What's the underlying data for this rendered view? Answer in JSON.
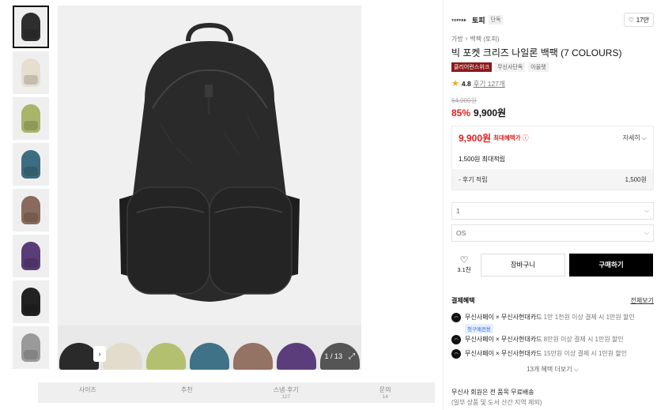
{
  "thumbnails": [
    {
      "color": "#2e2e2e"
    },
    {
      "color": "#e6dfd0"
    },
    {
      "color": "#a8b56a"
    },
    {
      "color": "#3c6d80"
    },
    {
      "color": "#8a6a5c"
    },
    {
      "color": "#5a3c78"
    },
    {
      "color": "#222222"
    },
    {
      "color": "#9a9a9a"
    }
  ],
  "main_image": {
    "backpack_color": "#2a2a2a",
    "counter": "1 / 13",
    "swatches": [
      {
        "color": "#2a2a2a"
      },
      {
        "color": "#e3dccd"
      },
      {
        "color": "#b3c070"
      },
      {
        "color": "#3f7286"
      },
      {
        "color": "#947264"
      },
      {
        "color": "#5b3d7c"
      },
      {
        "color": "#555555"
      }
    ]
  },
  "tabs": [
    {
      "label": "사이즈",
      "count": ""
    },
    {
      "label": "추천",
      "count": ""
    },
    {
      "label": "스냅·후기",
      "count": "127"
    },
    {
      "label": "문의",
      "count": "14"
    }
  ],
  "brand": {
    "logo": "TOFFEE",
    "name": "토피",
    "tag": "단독",
    "likes": "17만"
  },
  "breadcrumb": [
    "가방",
    "백팩 (토피)"
  ],
  "product": {
    "title": "빅 포켓 크리즈 나일론 백팩 (7 COLOURS)",
    "badge_primary": "클리어런스위크",
    "badge_secondary": [
      "무신사단독",
      "아울렛"
    ],
    "rating": "4.8",
    "reviews": "후기 127개",
    "original_price": "64,000원",
    "discount": "85%",
    "price": "9,900원"
  },
  "benefit": {
    "price": "9,900원",
    "label": "최대혜택가",
    "detail": "자세히",
    "points": "1,500원 최대적립",
    "review_label": "- 후기 적립",
    "review_value": "1,500원"
  },
  "options": {
    "select1": "1",
    "select2": "OS"
  },
  "actions": {
    "fav_count": "3.1천",
    "cart": "장바구니",
    "buy": "구매하기"
  },
  "payment": {
    "title": "결제혜택",
    "view_all": "전체보기",
    "items": [
      {
        "card": "무신사페이 × 무신사현대카드",
        "desc": "1만 1천원 이상 결제 시 1만원 할인",
        "tag": "첫구매전용"
      },
      {
        "card": "무신사페이 × 무신사현대카드",
        "desc": "8만원 이상 결제 시 1만원 할인",
        "tag": ""
      },
      {
        "card": "무신사페이 × 무신사현대카드",
        "desc": "15만원 이상 결제 시 1만원 할인",
        "tag": ""
      }
    ],
    "more": "13개 혜택 더보기"
  },
  "shipping": {
    "line1": "무신사 회원은 전 품목 무료배송",
    "line2": "(일부 상품 및 도서 산간 지역 제외)"
  }
}
